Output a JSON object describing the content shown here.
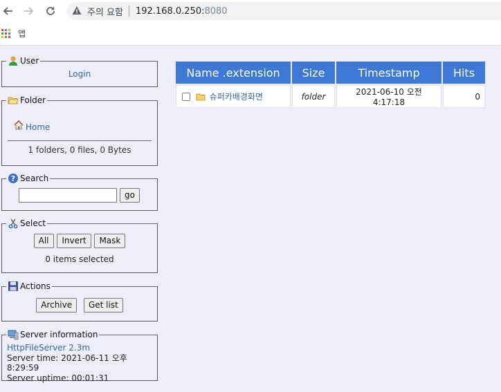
{
  "browser": {
    "security_warning": "주의 요함",
    "url_host": "192.168.0.250:",
    "url_port": "8080",
    "bookmark_apps_label": "앱",
    "accent_color": "#3d78d6"
  },
  "panels": {
    "user": {
      "title": "User",
      "login": "Login"
    },
    "folder": {
      "title": "Folder",
      "home": "Home",
      "summary": "1 folders, 0 files, 0 Bytes"
    },
    "search": {
      "title": "Search",
      "query": "",
      "go": "go"
    },
    "select": {
      "title": "Select",
      "all": "All",
      "invert": "Invert",
      "mask": "Mask",
      "status": "0 items selected"
    },
    "actions": {
      "title": "Actions",
      "archive": "Archive",
      "get_list": "Get list"
    },
    "server": {
      "title": "Server information",
      "software": "HttpFileServer 2.3m",
      "time": "Server time: 2021-06-11 오후 8:29:59",
      "uptime": "Server uptime: 00:01:31"
    }
  },
  "file_table": {
    "columns": [
      "Name .extension",
      "Size",
      "Timestamp",
      "Hits"
    ],
    "rows": [
      {
        "name": "슈퍼카배경화면",
        "size": "folder",
        "timestamp": "2021-06-10 오전 4:17:18",
        "hits": "0"
      }
    ]
  }
}
